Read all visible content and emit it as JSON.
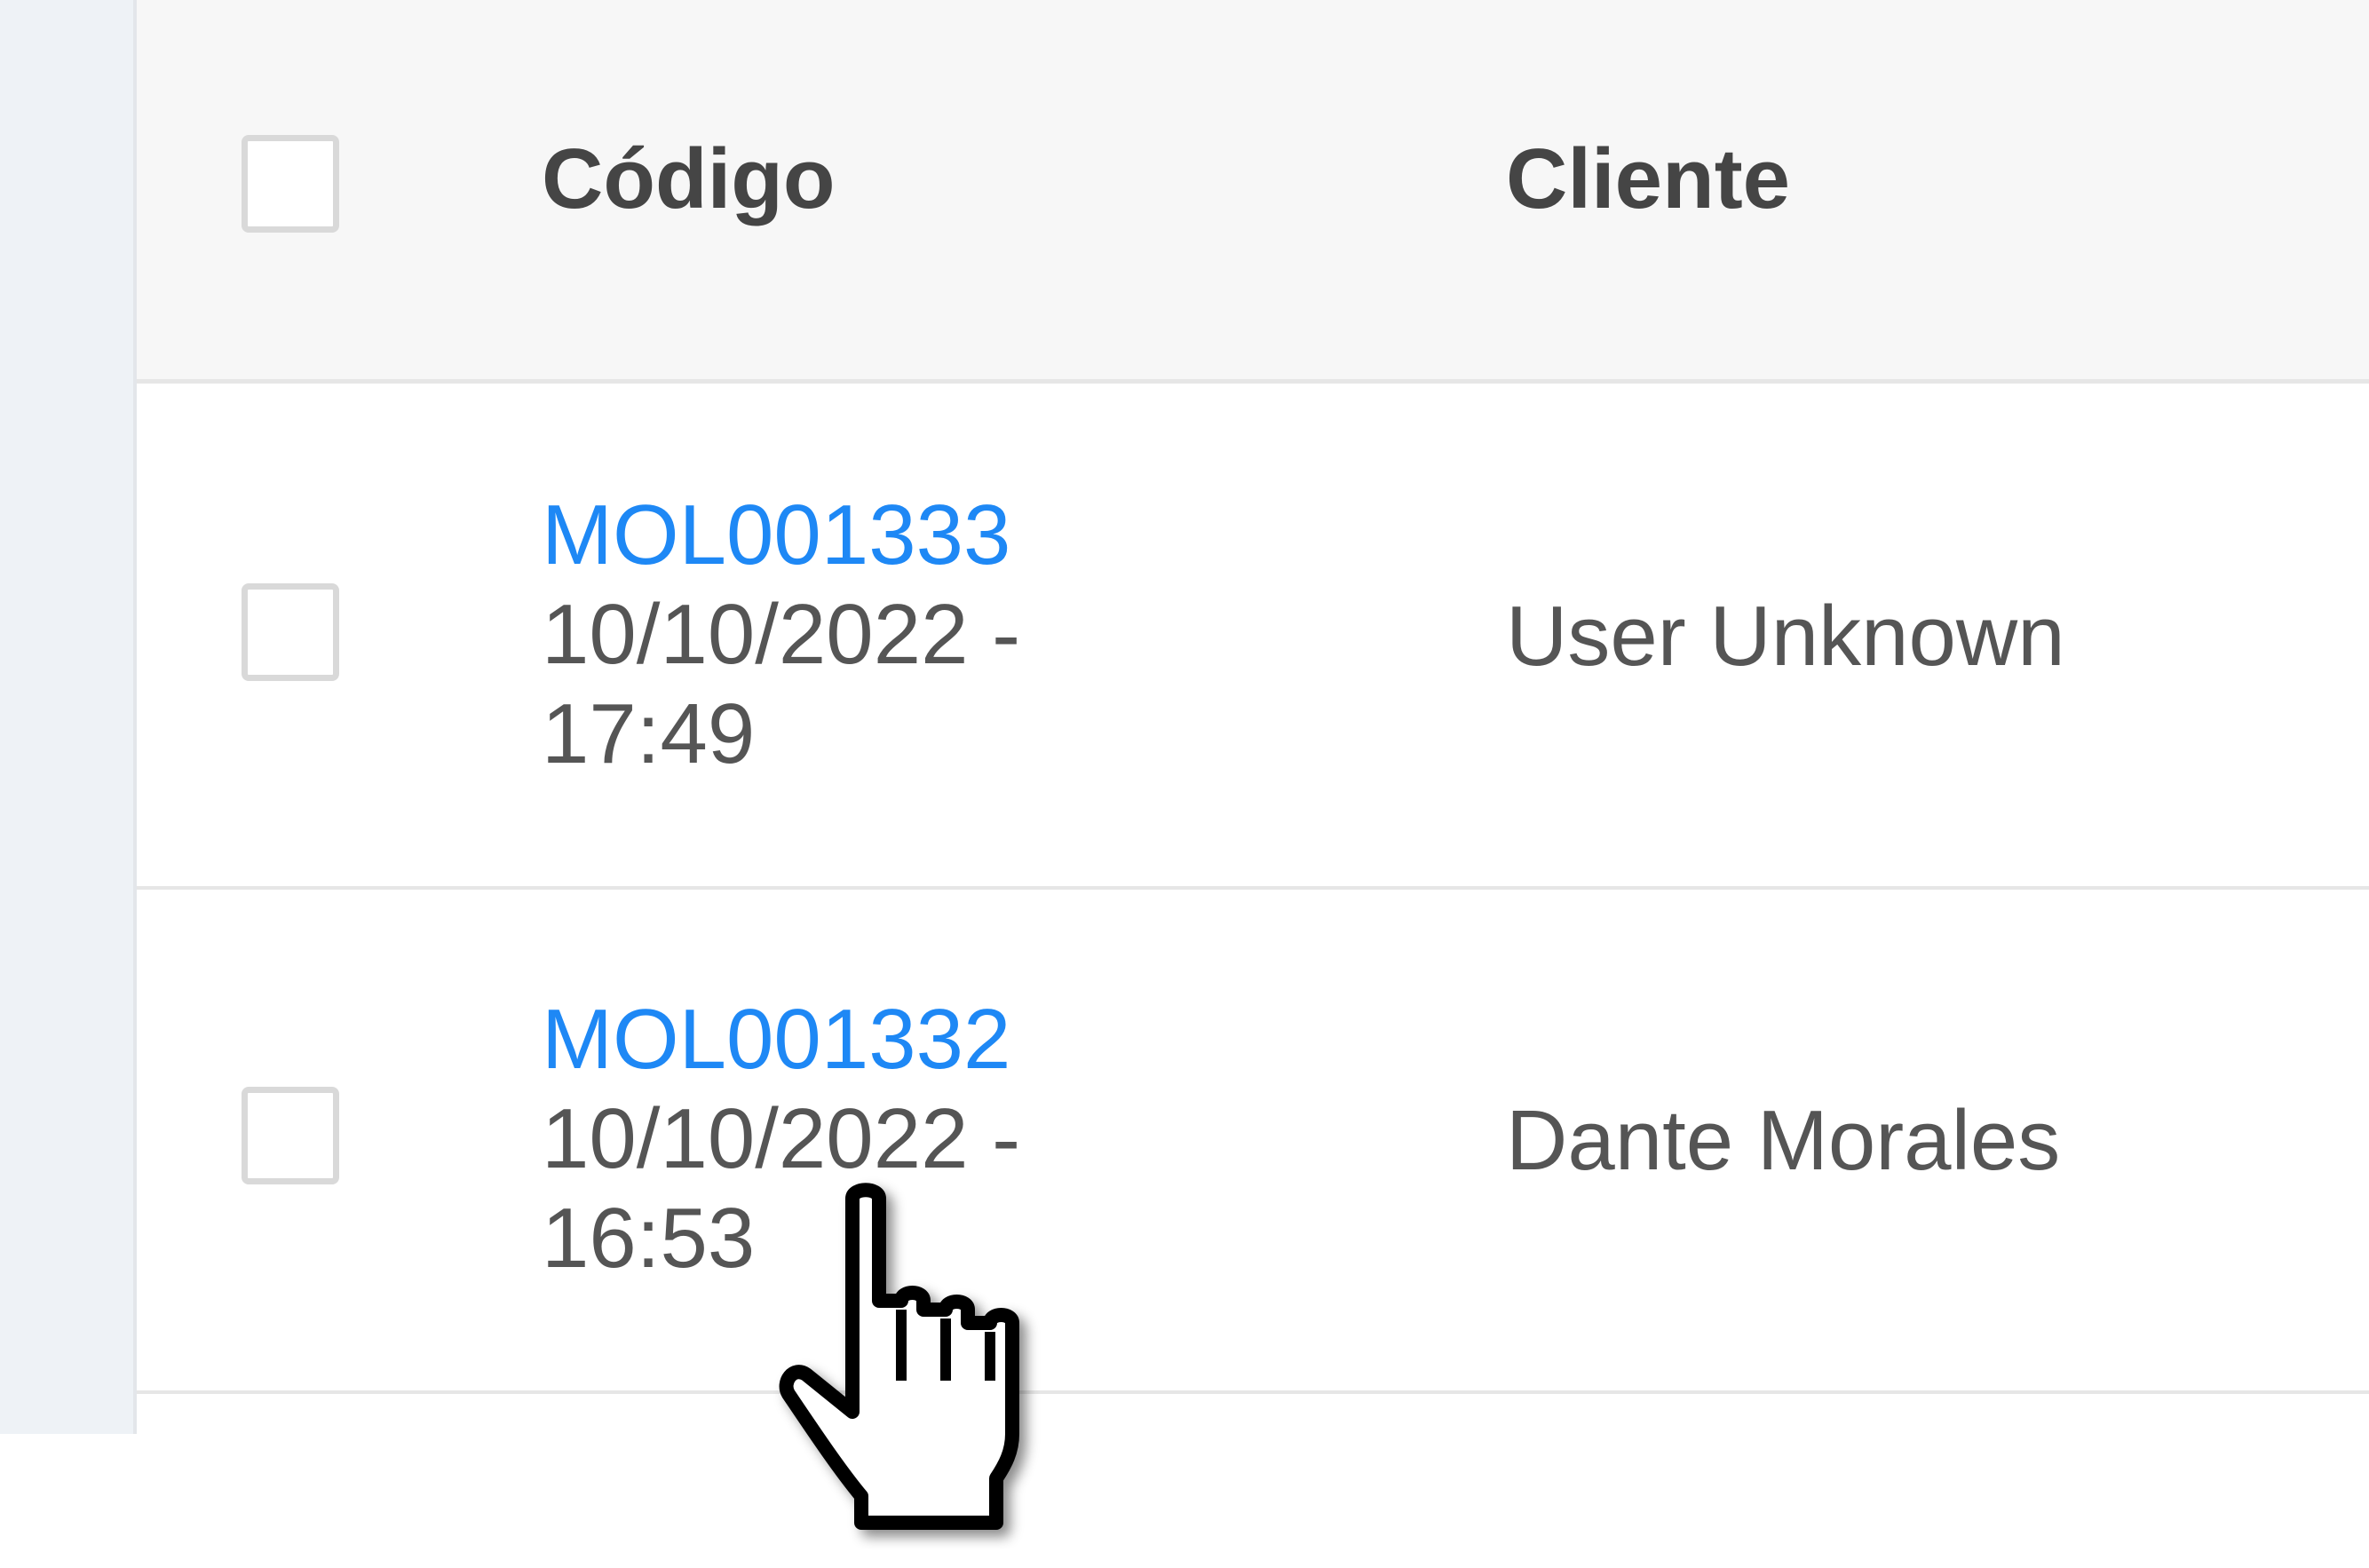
{
  "table": {
    "headers": {
      "codigo": "Código",
      "cliente": "Cliente"
    },
    "rows": [
      {
        "code": "MOL001333",
        "date": "10/10/2022 -",
        "time": "17:49",
        "client": "User Unknown"
      },
      {
        "code": "MOL001332",
        "date": "10/10/2022 -",
        "time": "16:53",
        "client": "Dante Morales"
      }
    ]
  },
  "colors": {
    "link": "#1e88f5",
    "text": "#555555",
    "header_bg": "#f7f7f7",
    "sidebar_bg": "#eef2f6"
  },
  "cursor": {
    "icon": "hand-pointer-icon"
  }
}
